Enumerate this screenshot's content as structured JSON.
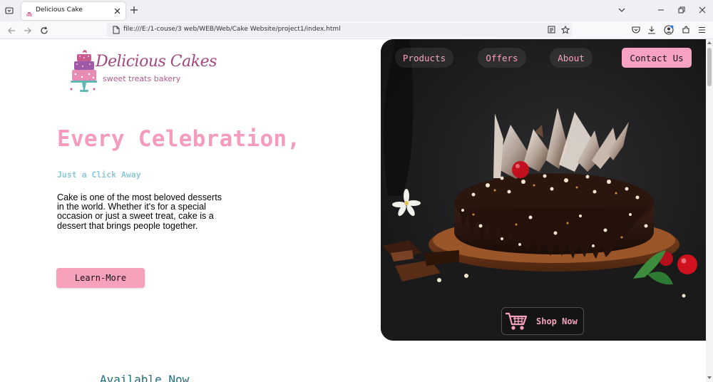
{
  "browser": {
    "tab_title": "Delicious Cake",
    "url": "file:///E:/1-couse/3 web/WEB/Web/Cake Website/project1/index.html"
  },
  "site": {
    "logo": {
      "title": "Delicious Cakes",
      "tagline": "sweet treats bakery"
    },
    "nav": {
      "products": "Products",
      "offers": "Offers",
      "about": "About",
      "contact": "Contact Us"
    },
    "hero": {
      "title": "Every Celebration,",
      "subtitle": "Just a Click Away",
      "description": "Cake is one of the most beloved desserts in the world. Whether it's for a special occasion or just a sweet treat, cake is a dessert that brings people together.",
      "button": "Learn-More",
      "shop_button": "Shop Now"
    },
    "section_heading": "Available Now"
  },
  "colors": {
    "accent_pink": "#f7a1bb",
    "title_pink": "#f59bbd",
    "subtitle_teal": "#8ec9d8",
    "heading_teal": "#1f6e80",
    "card_dark": "#1d1d1f"
  },
  "icons": {
    "cart": "shopping-cart-icon"
  }
}
